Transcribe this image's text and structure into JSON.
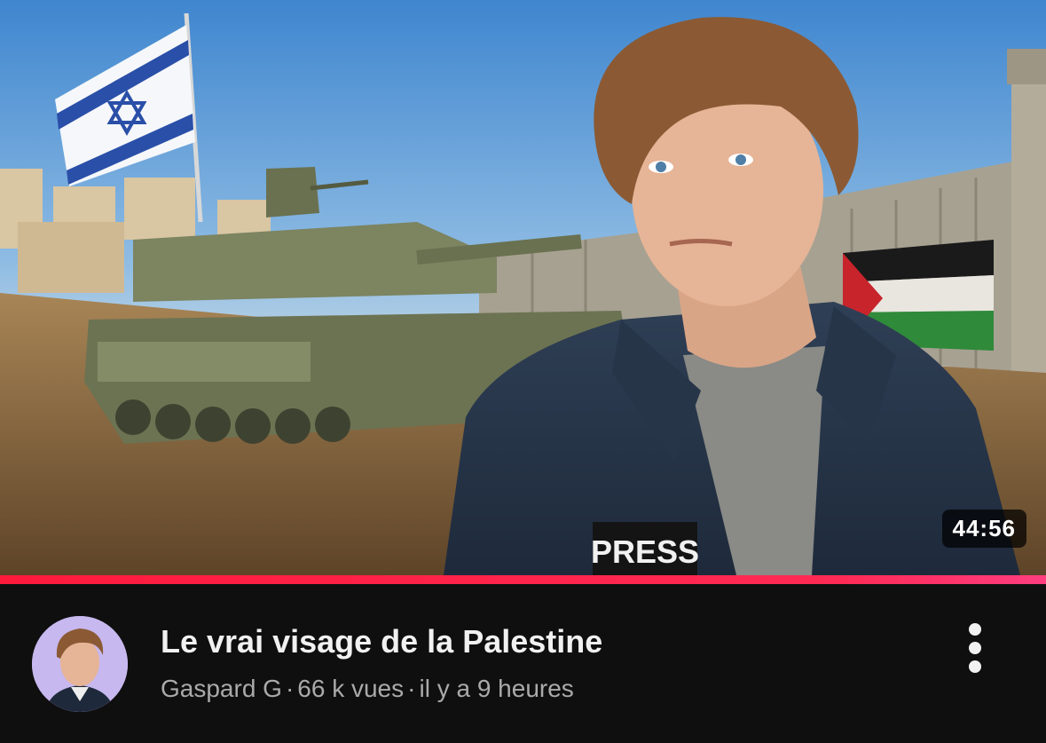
{
  "video": {
    "title": "Le vrai visage de la Palestine",
    "channel": "Gaspard G",
    "views": "66 k vues",
    "age": "il y a 9 heures",
    "separator": "·",
    "duration": "44:56",
    "watched_fraction": 1.0
  },
  "thumbnail": {
    "badge_text": "PRESS"
  },
  "colors": {
    "background": "#0f0f0f",
    "title": "#f1f1f1",
    "subtitle": "#aaaaaa",
    "progress": "#ff1a3c",
    "avatar_bg": "#c7b8ef"
  },
  "icons": {
    "more": "more-vertical-icon"
  }
}
